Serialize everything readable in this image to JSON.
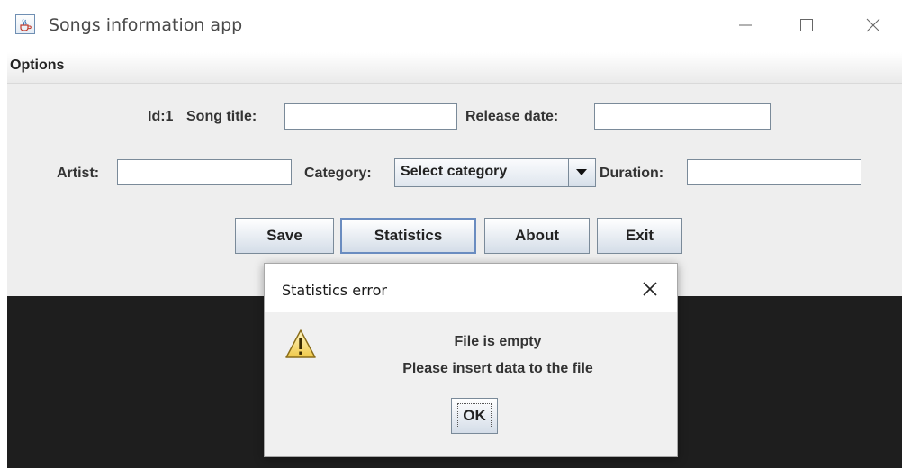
{
  "window": {
    "title": "Songs information app",
    "icon": "java-cup-icon"
  },
  "menubar": {
    "options_label": "Options"
  },
  "form": {
    "id_label": "Id:1",
    "song_title_label": "Song title:",
    "song_title_value": "",
    "release_date_label": "Release date:",
    "release_date_value": "",
    "artist_label": "Artist:",
    "artist_value": "",
    "category_label": "Category:",
    "category_selected": "Select  category",
    "duration_label": "Duration:",
    "duration_value": ""
  },
  "buttons": {
    "save": "Save",
    "statistics": "Statistics",
    "about": "About",
    "exit": "Exit"
  },
  "dialog": {
    "title": "Statistics error",
    "icon": "warning-icon",
    "message_line1": "File is empty",
    "message_line2": "Please insert data to the file",
    "ok_label": "OK"
  }
}
